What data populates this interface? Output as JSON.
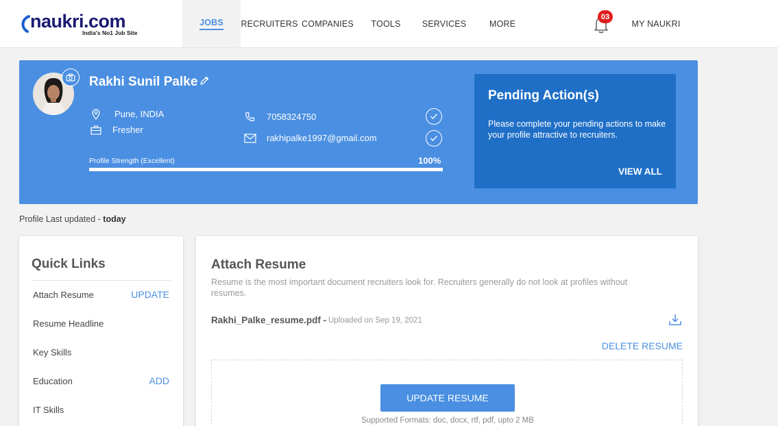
{
  "brand": {
    "logo_text": "naukri.com",
    "tagline": "India's No1 Job Site"
  },
  "nav": {
    "items": [
      "JOBS",
      "RECRUITERS",
      "COMPANIES",
      "TOOLS",
      "SERVICES",
      "MORE"
    ],
    "active": "JOBS",
    "notifications_count": "03",
    "account_label": "MY NAUKRI"
  },
  "profile": {
    "name": "Rakhi Sunil Palke",
    "location": "Pune, INDIA",
    "experience": "Fresher",
    "phone": "7058324750",
    "email": "rakhipalke1997@gmail.com",
    "strength_label": "Profile Strength (Excellent)",
    "strength_value": "100%",
    "strength_fraction": 1.0,
    "last_updated_label": "Profile Last updated - ",
    "last_updated_value": "today"
  },
  "pending": {
    "title": "Pending Action(s)",
    "text": "Please complete your pending actions to make your profile attractive to recruiters.",
    "link": "VIEW ALL"
  },
  "quick_links": {
    "title": "Quick Links",
    "items": [
      {
        "label": "Attach Resume",
        "action": "UPDATE"
      },
      {
        "label": "Resume Headline",
        "action": ""
      },
      {
        "label": "Key Skills",
        "action": ""
      },
      {
        "label": "Education",
        "action": "ADD"
      },
      {
        "label": "IT Skills",
        "action": ""
      }
    ]
  },
  "attach": {
    "title": "Attach Resume",
    "description": "Resume is the most important document recruiters look for. Recruiters generally do not look at profiles without resumes.",
    "file_name": "Rakhi_Palke_resume.pdf -",
    "uploaded": "Uploaded on Sep 19, 2021",
    "delete_label": "DELETE RESUME",
    "update_label": "UPDATE RESUME",
    "formats": "Supported Formats: doc, docx, rtf, pdf, upto 2 MB"
  },
  "colors": {
    "primary_blue": "#4a8fe2",
    "dark_blue": "#1f6fc7",
    "badge_red": "#e01e1e",
    "link_blue": "#4a90e2"
  }
}
